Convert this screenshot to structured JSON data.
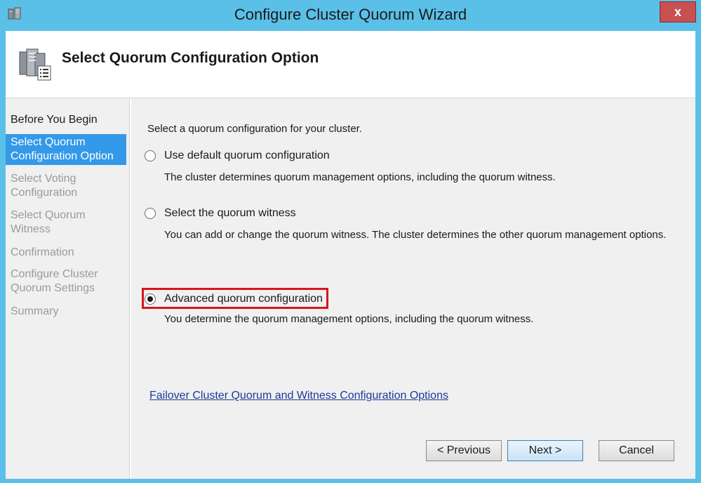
{
  "window": {
    "title": "Configure Cluster Quorum Wizard",
    "close_label": "x"
  },
  "header": {
    "title": "Select Quorum Configuration Option",
    "icon": "cluster-server-icon"
  },
  "nav": {
    "items": [
      {
        "label": "Before You Begin",
        "state": "done"
      },
      {
        "label": "Select Quorum Configuration Option",
        "state": "active"
      },
      {
        "label": "Select Voting Configuration",
        "state": "pending"
      },
      {
        "label": "Select Quorum Witness",
        "state": "pending"
      },
      {
        "label": "Confirmation",
        "state": "pending"
      },
      {
        "label": "Configure Cluster Quorum Settings",
        "state": "pending"
      },
      {
        "label": "Summary",
        "state": "pending"
      }
    ]
  },
  "content": {
    "prompt": "Select a quorum configuration for your cluster.",
    "options": [
      {
        "label": "Use default quorum configuration",
        "description": "The cluster determines quorum management options, including the quorum witness.",
        "selected": false
      },
      {
        "label": "Select the quorum witness",
        "description": "You can add or change the quorum witness. The cluster determines the other quorum management options.",
        "selected": false
      },
      {
        "label": "Advanced quorum configuration",
        "description": "You determine the quorum management options, including the quorum witness.",
        "selected": true
      }
    ],
    "help_link": "Failover Cluster Quorum and Witness Configuration Options"
  },
  "buttons": {
    "previous": "< Previous",
    "next": "Next >",
    "cancel": "Cancel"
  },
  "colors": {
    "titlebar": "#5bc0e8",
    "nav_active": "#3399e8",
    "highlight": "#d8141c",
    "link": "#1a3a9a"
  }
}
